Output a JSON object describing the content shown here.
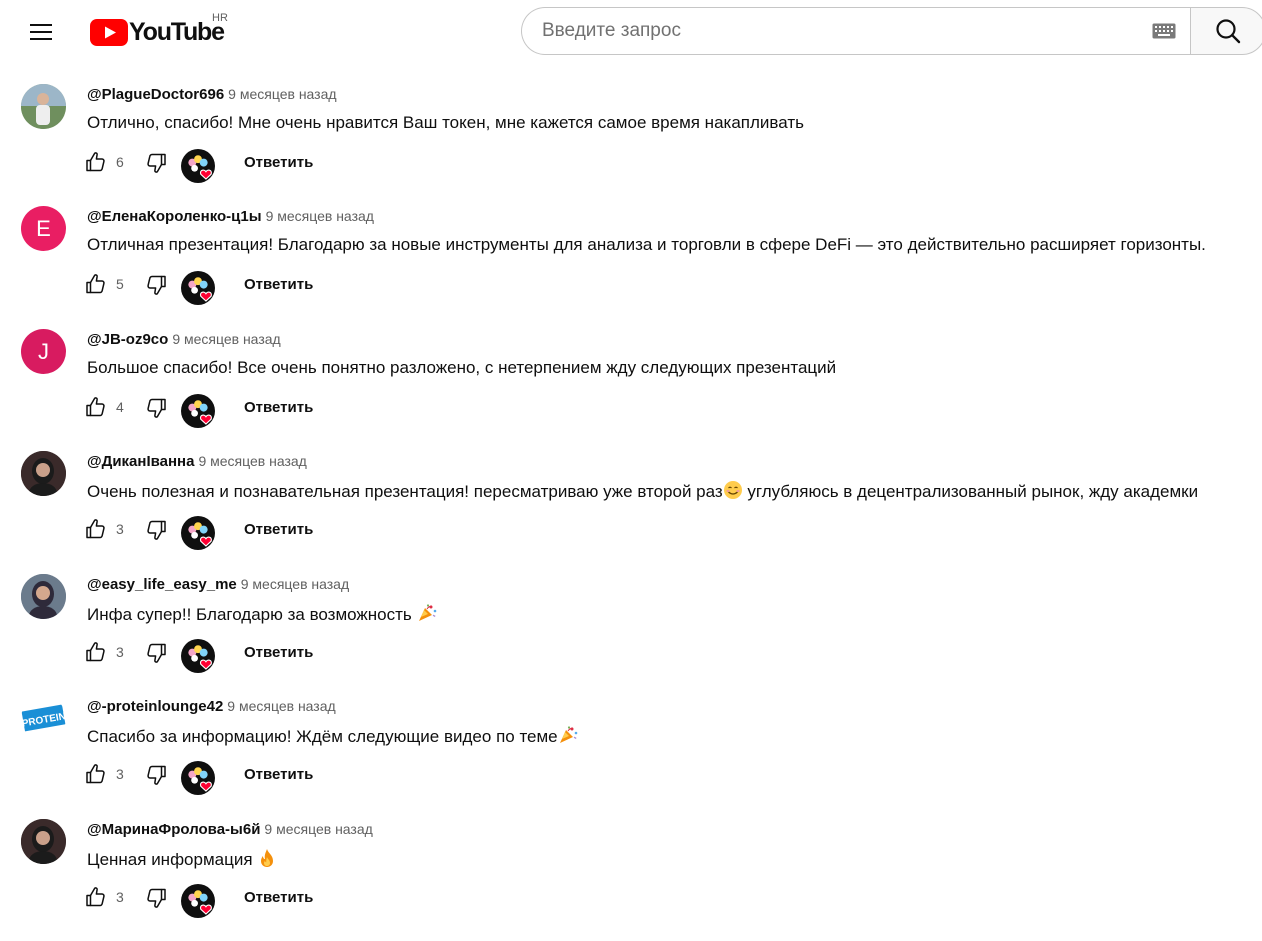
{
  "header": {
    "logo_text": "YouTube",
    "region": "HR",
    "search_placeholder": "Введите запрос"
  },
  "colors": {
    "brand_red": "#ff0000",
    "time_gray": "#606060"
  },
  "comments": [
    {
      "author": "@PlagueDoctor696",
      "time": "9 месяцев назад",
      "text": "Отлично, спасибо! Мне очень нравится Ваш токен, мне кажется самое время накапливать",
      "likes": "6",
      "reply": "Ответить",
      "avatar": "photo-man-icon"
    },
    {
      "author": "@ЕленаКороленко-ц1ы",
      "time": "9 месяцев назад",
      "text": "Отличная презентация! Благодарю за новые инструменты для анализа и торговли в сфере DeFi — это действительно расширяет горизонты.",
      "likes": "5",
      "reply": "Ответить",
      "avatar_letter": "E",
      "avatar_color": "#e91e63"
    },
    {
      "author": "@JB-oz9co",
      "time": "9 месяцев назад",
      "text": "Большое спасибо! Все очень понятно разложено, с нетерпением жду следующих презентаций",
      "likes": "4",
      "reply": "Ответить",
      "avatar_letter": "J",
      "avatar_color": "#d81b60"
    },
    {
      "author": "@ДиканІванна",
      "time": "9 месяцев назад",
      "text_before": "Очень полезная и познавательная презентация! пересматриваю уже второй раз",
      "text_after": " углубляюсь в децентрализованный рынок, жду академки",
      "emoji": "smiling-face-emoji",
      "likes": "3",
      "reply": "Ответить",
      "avatar": "photo-woman-icon"
    },
    {
      "author": "@easy_life_easy_me",
      "time": "9 месяцев назад",
      "text_before": "Инфа супер!! Благодарю за возможность ",
      "text_after": "",
      "emoji": "party-popper-emoji",
      "likes": "3",
      "reply": "Ответить",
      "avatar": "photo-woman-icon"
    },
    {
      "author": "@-proteinlounge42",
      "time": "9 месяцев назад",
      "text_before": "Спасибо за информацию!  Ждём следующие видео по теме",
      "text_after": "",
      "emoji": "party-popper-emoji",
      "likes": "3",
      "reply": "Ответить",
      "avatar": "protein-logo-icon",
      "avatar_label": "PROTEIN"
    },
    {
      "author": "@МаринаФролова-ы6й",
      "time": "9 месяцев назад",
      "text_before": "Ценная информация ",
      "text_after": "",
      "emoji": "fire-emoji",
      "likes": "3",
      "reply": "Ответить",
      "avatar": "photo-woman-icon"
    }
  ]
}
